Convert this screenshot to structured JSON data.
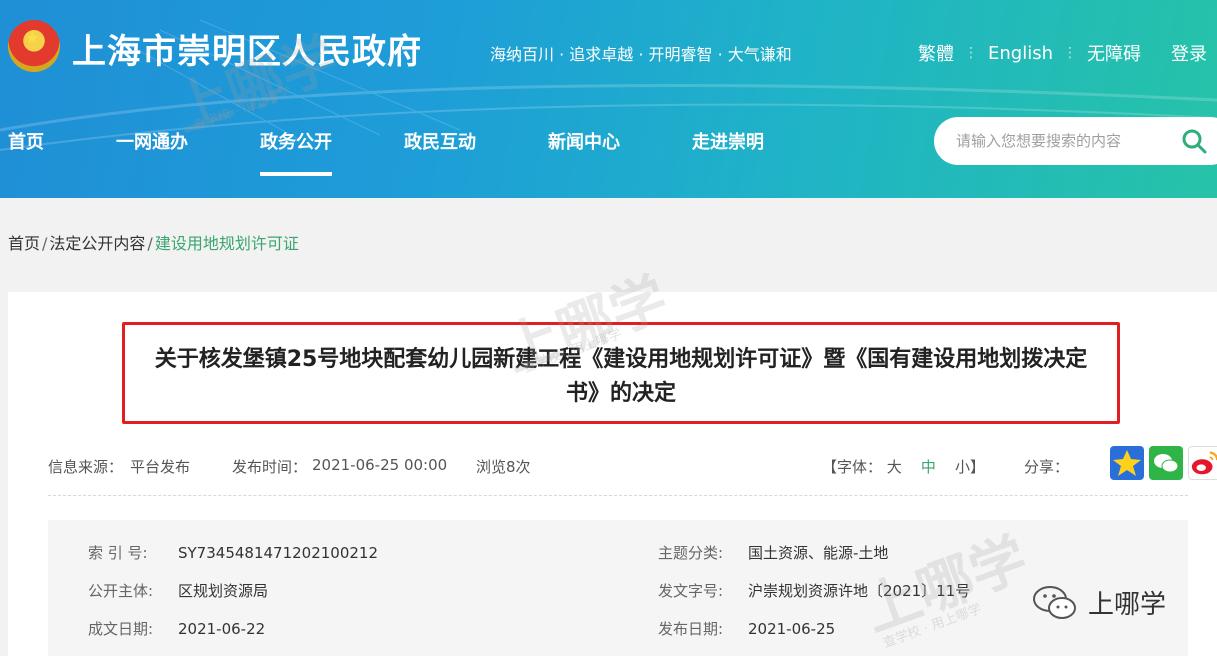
{
  "header": {
    "site_title": "上海市崇明区人民政府",
    "slogan": "海纳百川 · 追求卓越 · 开明睿智 · 大气谦和",
    "links": [
      "繁體",
      "English",
      "无障碍"
    ],
    "login": "登录"
  },
  "nav": [
    "首页",
    "一网通办",
    "政务公开",
    "政民互动",
    "新闻中心",
    "走进崇明"
  ],
  "search": {
    "placeholder": "请输入您想要搜索的内容"
  },
  "breadcrumb": {
    "home": "首页",
    "section": "法定公开内容",
    "current": "建设用地规划许可证"
  },
  "article": {
    "title": "关于核发堡镇25号地块配套幼儿园新建工程《建设用地规划许可证》暨《国有建设用地划拨决定书》的决定",
    "source_label": "信息来源：",
    "source": "平台发布",
    "time_label": "发布时间：",
    "time": "2021-06-25 00:00",
    "views": "浏览8次",
    "font_label": "【字体：",
    "font_large": "大",
    "font_mid": "中",
    "font_small": "小】",
    "share_label": "分享："
  },
  "info": {
    "index_label": "索 引 号:",
    "index": "SY7345481471202100212",
    "subject_label": "主题分类:",
    "subject": "国土资源、能源-土地",
    "publisher_label": "公开主体:",
    "publisher": "区规划资源局",
    "docno_label": "发文字号:",
    "docno": "沪崇规划资源许地〔2021〕11号",
    "created_label": "成文日期:",
    "created": "2021-06-22",
    "published_label": "发布日期:",
    "published": "2021-06-25"
  },
  "watermark": {
    "text": "上哪学",
    "small": "查学校 · 用上哪学"
  },
  "brand": {
    "name": "上哪学"
  },
  "colors": {
    "accent_green": "#3aa56e",
    "highlight_red": "#e02020",
    "header_blue": "#1f8fd6",
    "header_teal": "#26c3a8"
  }
}
